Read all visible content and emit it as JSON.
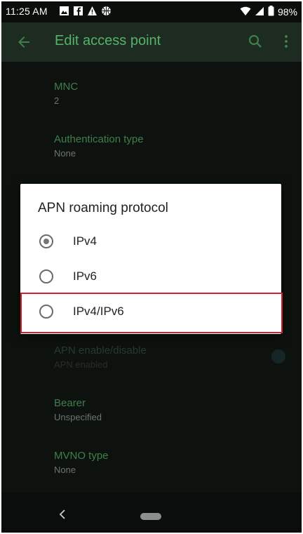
{
  "status_bar": {
    "time": "11:25 AM",
    "battery": "98%",
    "icons": [
      "gallery-icon",
      "facebook-icon",
      "alert-icon",
      "basketball-icon",
      "wifi-icon",
      "signal-icon",
      "battery-icon"
    ]
  },
  "app_bar": {
    "title": "Edit access point",
    "icons": [
      "back-arrow-icon",
      "search-icon",
      "more-vert-icon"
    ]
  },
  "settings": [
    {
      "title": "MNC",
      "value": "2",
      "enabled": true
    },
    {
      "title": "Authentication type",
      "value": "None",
      "enabled": true
    },
    {
      "title": "APN enable/disable",
      "value": "APN enabled",
      "enabled": false
    },
    {
      "title": "Bearer",
      "value": "Unspecified",
      "enabled": true
    },
    {
      "title": "MVNO type",
      "value": "None",
      "enabled": true
    }
  ],
  "dialog": {
    "title": "APN roaming protocol",
    "options": [
      {
        "label": "IPv4",
        "selected": true
      },
      {
        "label": "IPv6",
        "selected": false
      },
      {
        "label": "IPv4/IPv6",
        "selected": false
      }
    ],
    "highlighted_option": "IPv4/IPv6"
  },
  "colors": {
    "accent": "#56b36a",
    "app_bar_bg": "#1e2b20",
    "background": "#0d120e",
    "highlight_border": "#d21f2b"
  }
}
